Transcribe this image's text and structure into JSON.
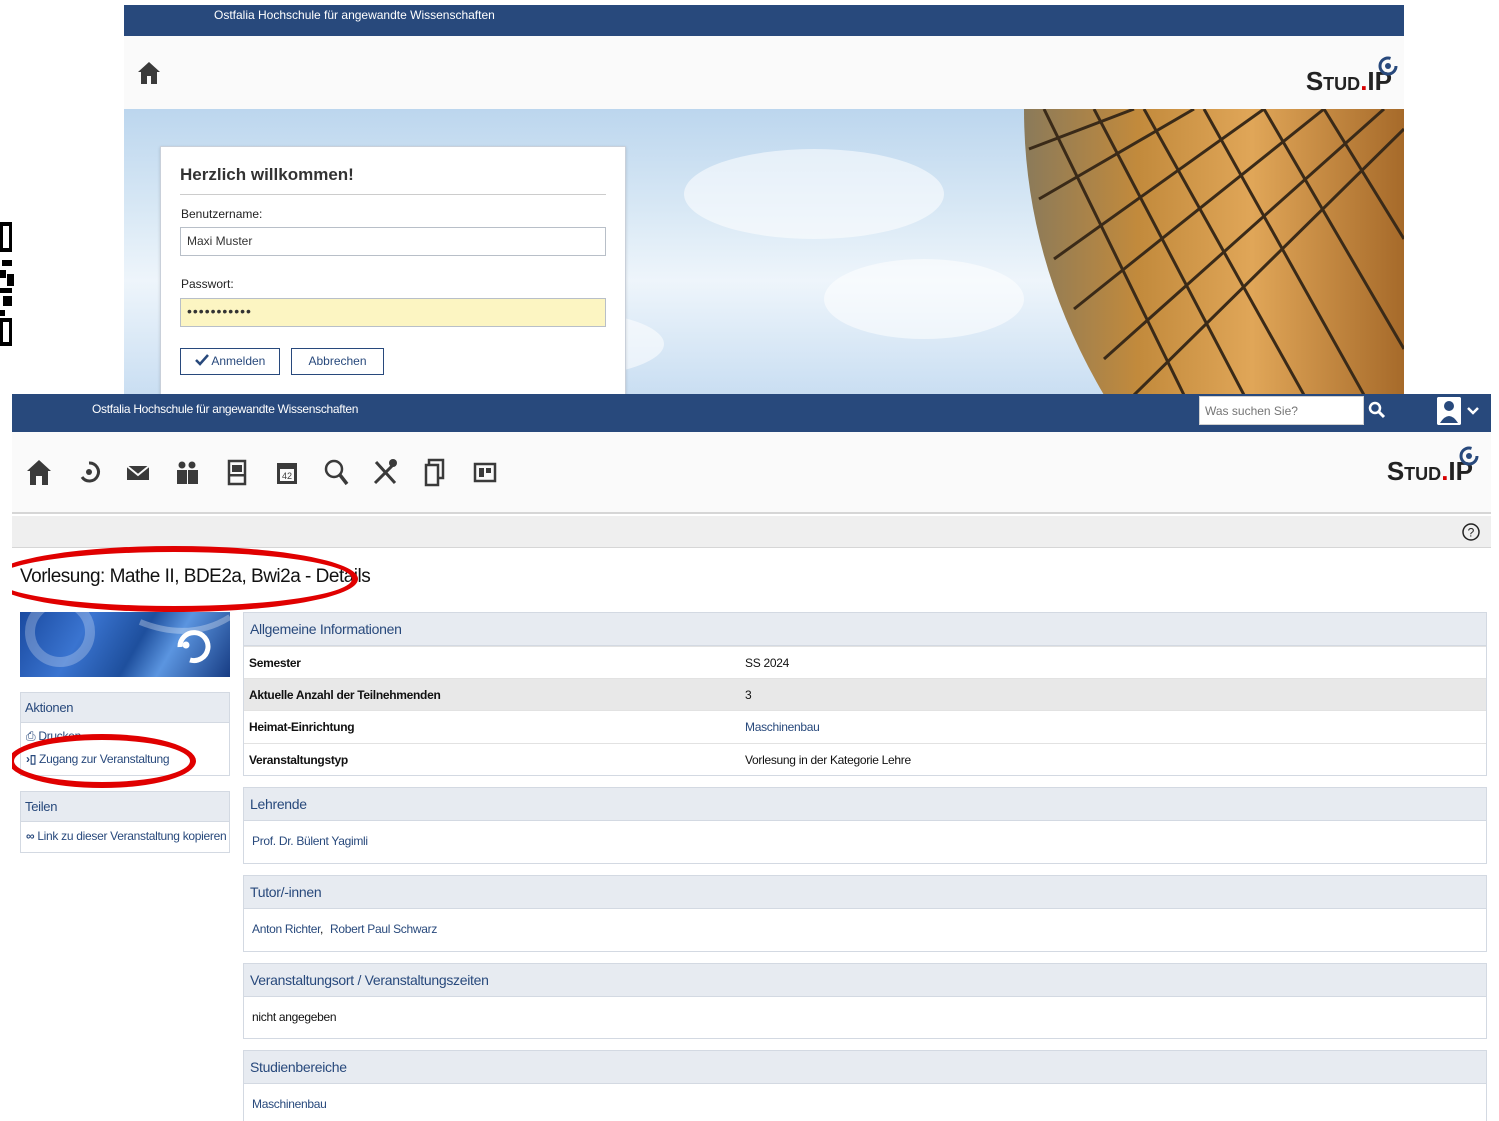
{
  "login": {
    "institution": "Ostfalia Hochschule für angewandte Wissenschaften",
    "logo_main": "Stud",
    "logo_dot": ".",
    "logo_end": "IP",
    "welcome": "Herzlich willkommen!",
    "username_label": "Benutzername:",
    "username_value": "Maxi Muster",
    "password_label": "Passwort:",
    "password_value": "•••••••••••",
    "login_button": "Anmelden",
    "cancel_button": "Abbrechen",
    "icons": {
      "home": "home-icon",
      "check": "checkmark-icon"
    }
  },
  "course": {
    "institution": "Ostfalia Hochschule für angewandte Wissenschaften",
    "search_placeholder": "Was suchen Sie?",
    "nav_icons": [
      "home-icon",
      "studip-icon",
      "mail-icon",
      "community-icon",
      "profile-icon",
      "calendar-icon",
      "search-icon",
      "tools-icon",
      "files-icon",
      "admin-icon"
    ],
    "page_title": "Vorlesung: Mathe II, BDE2a, Bwi2a - Details",
    "sidebar": {
      "actions_title": "Aktionen",
      "print_label": "Drucken",
      "access_label": "Zugang zur Veranstaltung",
      "share_title": "Teilen",
      "copy_link_label": "Link zu dieser Veranstaltung kopieren"
    },
    "general": {
      "title": "Allgemeine Informationen",
      "rows": [
        {
          "key": "Semester",
          "value": "SS 2024"
        },
        {
          "key": "Aktuelle Anzahl der Teilnehmenden",
          "value": "3"
        },
        {
          "key": "Heimat-Einrichtung",
          "value": "Maschinenbau"
        },
        {
          "key": "Veranstaltungstyp",
          "value": "Vorlesung in der Kategorie Lehre"
        }
      ]
    },
    "lecturers": {
      "title": "Lehrende",
      "names": [
        "Prof. Dr. Bülent Yagimli"
      ]
    },
    "tutors": {
      "title": "Tutor/-innen",
      "names": [
        "Anton Richter",
        "Robert Paul Schwarz"
      ],
      "separator": ","
    },
    "location": {
      "title": "Veranstaltungsort / Veranstaltungszeiten",
      "value": "nicht angegeben"
    },
    "study_areas": {
      "title": "Studienbereiche",
      "value": "Maschinenbau"
    }
  },
  "colors": {
    "brand": "#28497c",
    "highlight": "#e00000",
    "logo_dot": "#d60000"
  }
}
